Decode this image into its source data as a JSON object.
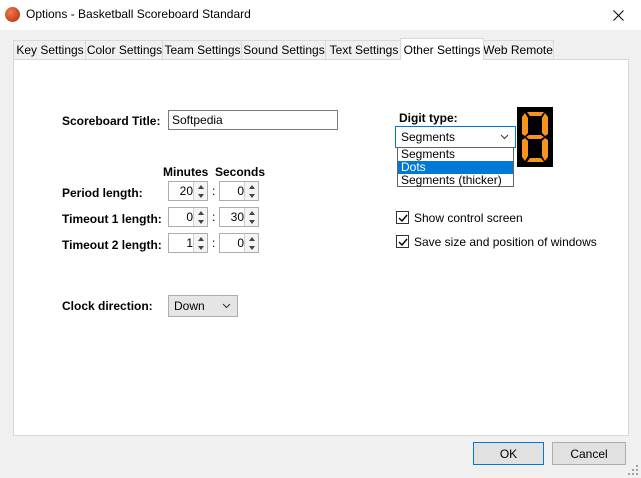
{
  "window": {
    "title": "Options - Basketball Scoreboard Standard"
  },
  "tabs": [
    {
      "label": "Key Settings"
    },
    {
      "label": "Color Settings"
    },
    {
      "label": "Team Settings"
    },
    {
      "label": "Sound Settings"
    },
    {
      "label": "Text Settings"
    },
    {
      "label": "Other Settings",
      "active": true
    },
    {
      "label": "Web Remote"
    }
  ],
  "form": {
    "scoreboard_title_label": "Scoreboard Title:",
    "scoreboard_title_value": "Softpedia",
    "minutes_header": "Minutes",
    "seconds_header": "Seconds",
    "separator": ":",
    "period": {
      "label": "Period length:",
      "minutes": "20",
      "seconds": "0"
    },
    "timeout1": {
      "label": "Timeout 1 length:",
      "minutes": "0",
      "seconds": "30"
    },
    "timeout2": {
      "label": "Timeout 2 length:",
      "minutes": "1",
      "seconds": "0"
    },
    "clock_direction_label": "Clock direction:",
    "clock_direction_value": "Down"
  },
  "digit": {
    "label": "Digit type:",
    "selected": "Segments",
    "options": [
      "Segments",
      "Dots",
      "Segments (thicker)"
    ],
    "highlighted_index": 1,
    "preview_color": "#f7941d"
  },
  "checkboxes": {
    "show_control_screen": {
      "label": "Show control screen",
      "checked": true
    },
    "save_size": {
      "label": "Save size and position of windows",
      "checked": true
    }
  },
  "buttons": {
    "ok": "OK",
    "cancel": "Cancel"
  },
  "colors": {
    "accent": "#0078d7",
    "panel": "#ffffff",
    "background": "#f0f0f0"
  }
}
